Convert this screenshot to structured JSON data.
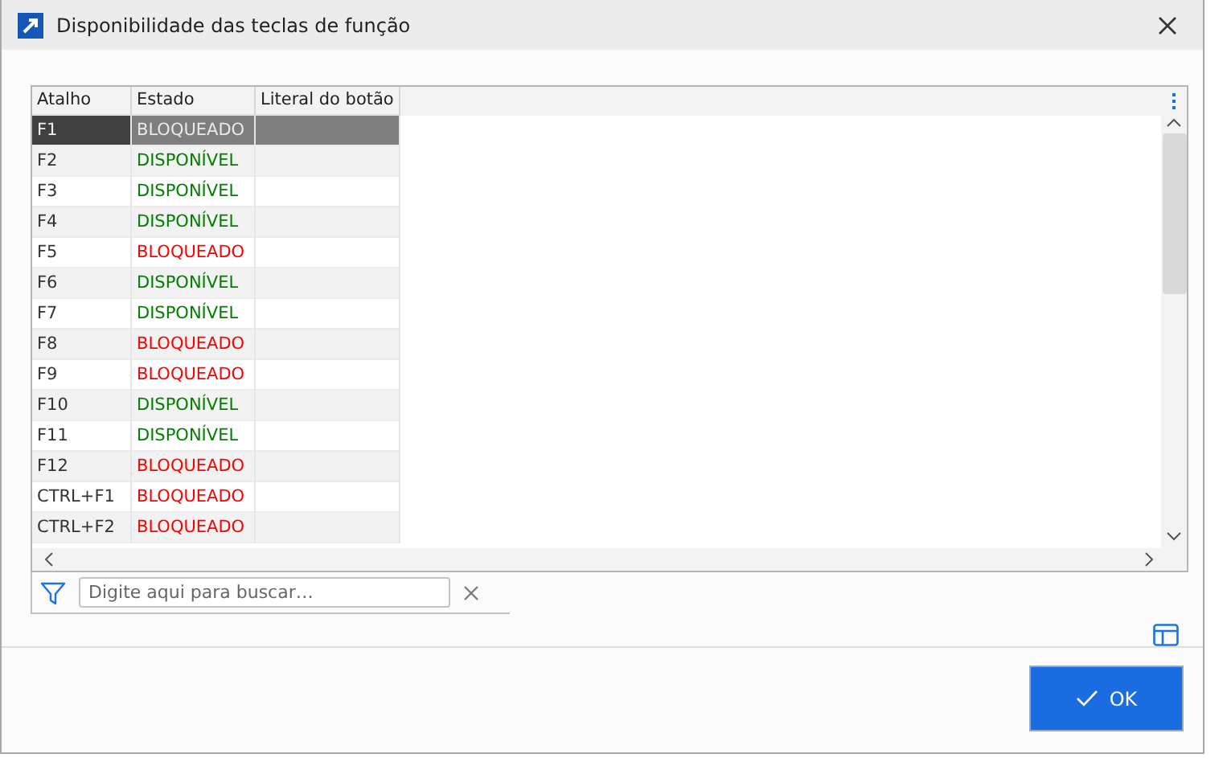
{
  "window": {
    "title": "Disponibilidade das teclas de função"
  },
  "table": {
    "columns": [
      "Atalho",
      "Estado",
      "Literal do botão"
    ],
    "rows": [
      {
        "shortcut": "F1",
        "status": "BLOQUEADO",
        "kind": "blocked",
        "selected": true
      },
      {
        "shortcut": "F2",
        "status": "DISPONÍVEL",
        "kind": "available",
        "selected": false
      },
      {
        "shortcut": "F3",
        "status": "DISPONÍVEL",
        "kind": "available",
        "selected": false
      },
      {
        "shortcut": "F4",
        "status": "DISPONÍVEL",
        "kind": "available",
        "selected": false
      },
      {
        "shortcut": "F5",
        "status": "BLOQUEADO",
        "kind": "blocked",
        "selected": false
      },
      {
        "shortcut": "F6",
        "status": "DISPONÍVEL",
        "kind": "available",
        "selected": false
      },
      {
        "shortcut": "F7",
        "status": "DISPONÍVEL",
        "kind": "available",
        "selected": false
      },
      {
        "shortcut": "F8",
        "status": "BLOQUEADO",
        "kind": "blocked",
        "selected": false
      },
      {
        "shortcut": "F9",
        "status": "BLOQUEADO",
        "kind": "blocked",
        "selected": false
      },
      {
        "shortcut": "F10",
        "status": "DISPONÍVEL",
        "kind": "available",
        "selected": false
      },
      {
        "shortcut": "F11",
        "status": "DISPONÍVEL",
        "kind": "available",
        "selected": false
      },
      {
        "shortcut": "F12",
        "status": "BLOQUEADO",
        "kind": "blocked",
        "selected": false
      },
      {
        "shortcut": "CTRL+F1",
        "status": "BLOQUEADO",
        "kind": "blocked",
        "selected": false
      },
      {
        "shortcut": "CTRL+F2",
        "status": "BLOQUEADO",
        "kind": "blocked",
        "selected": false
      }
    ]
  },
  "search": {
    "placeholder": "Digite aqui para buscar…"
  },
  "buttons": [
    {
      "label": "OK"
    }
  ]
}
